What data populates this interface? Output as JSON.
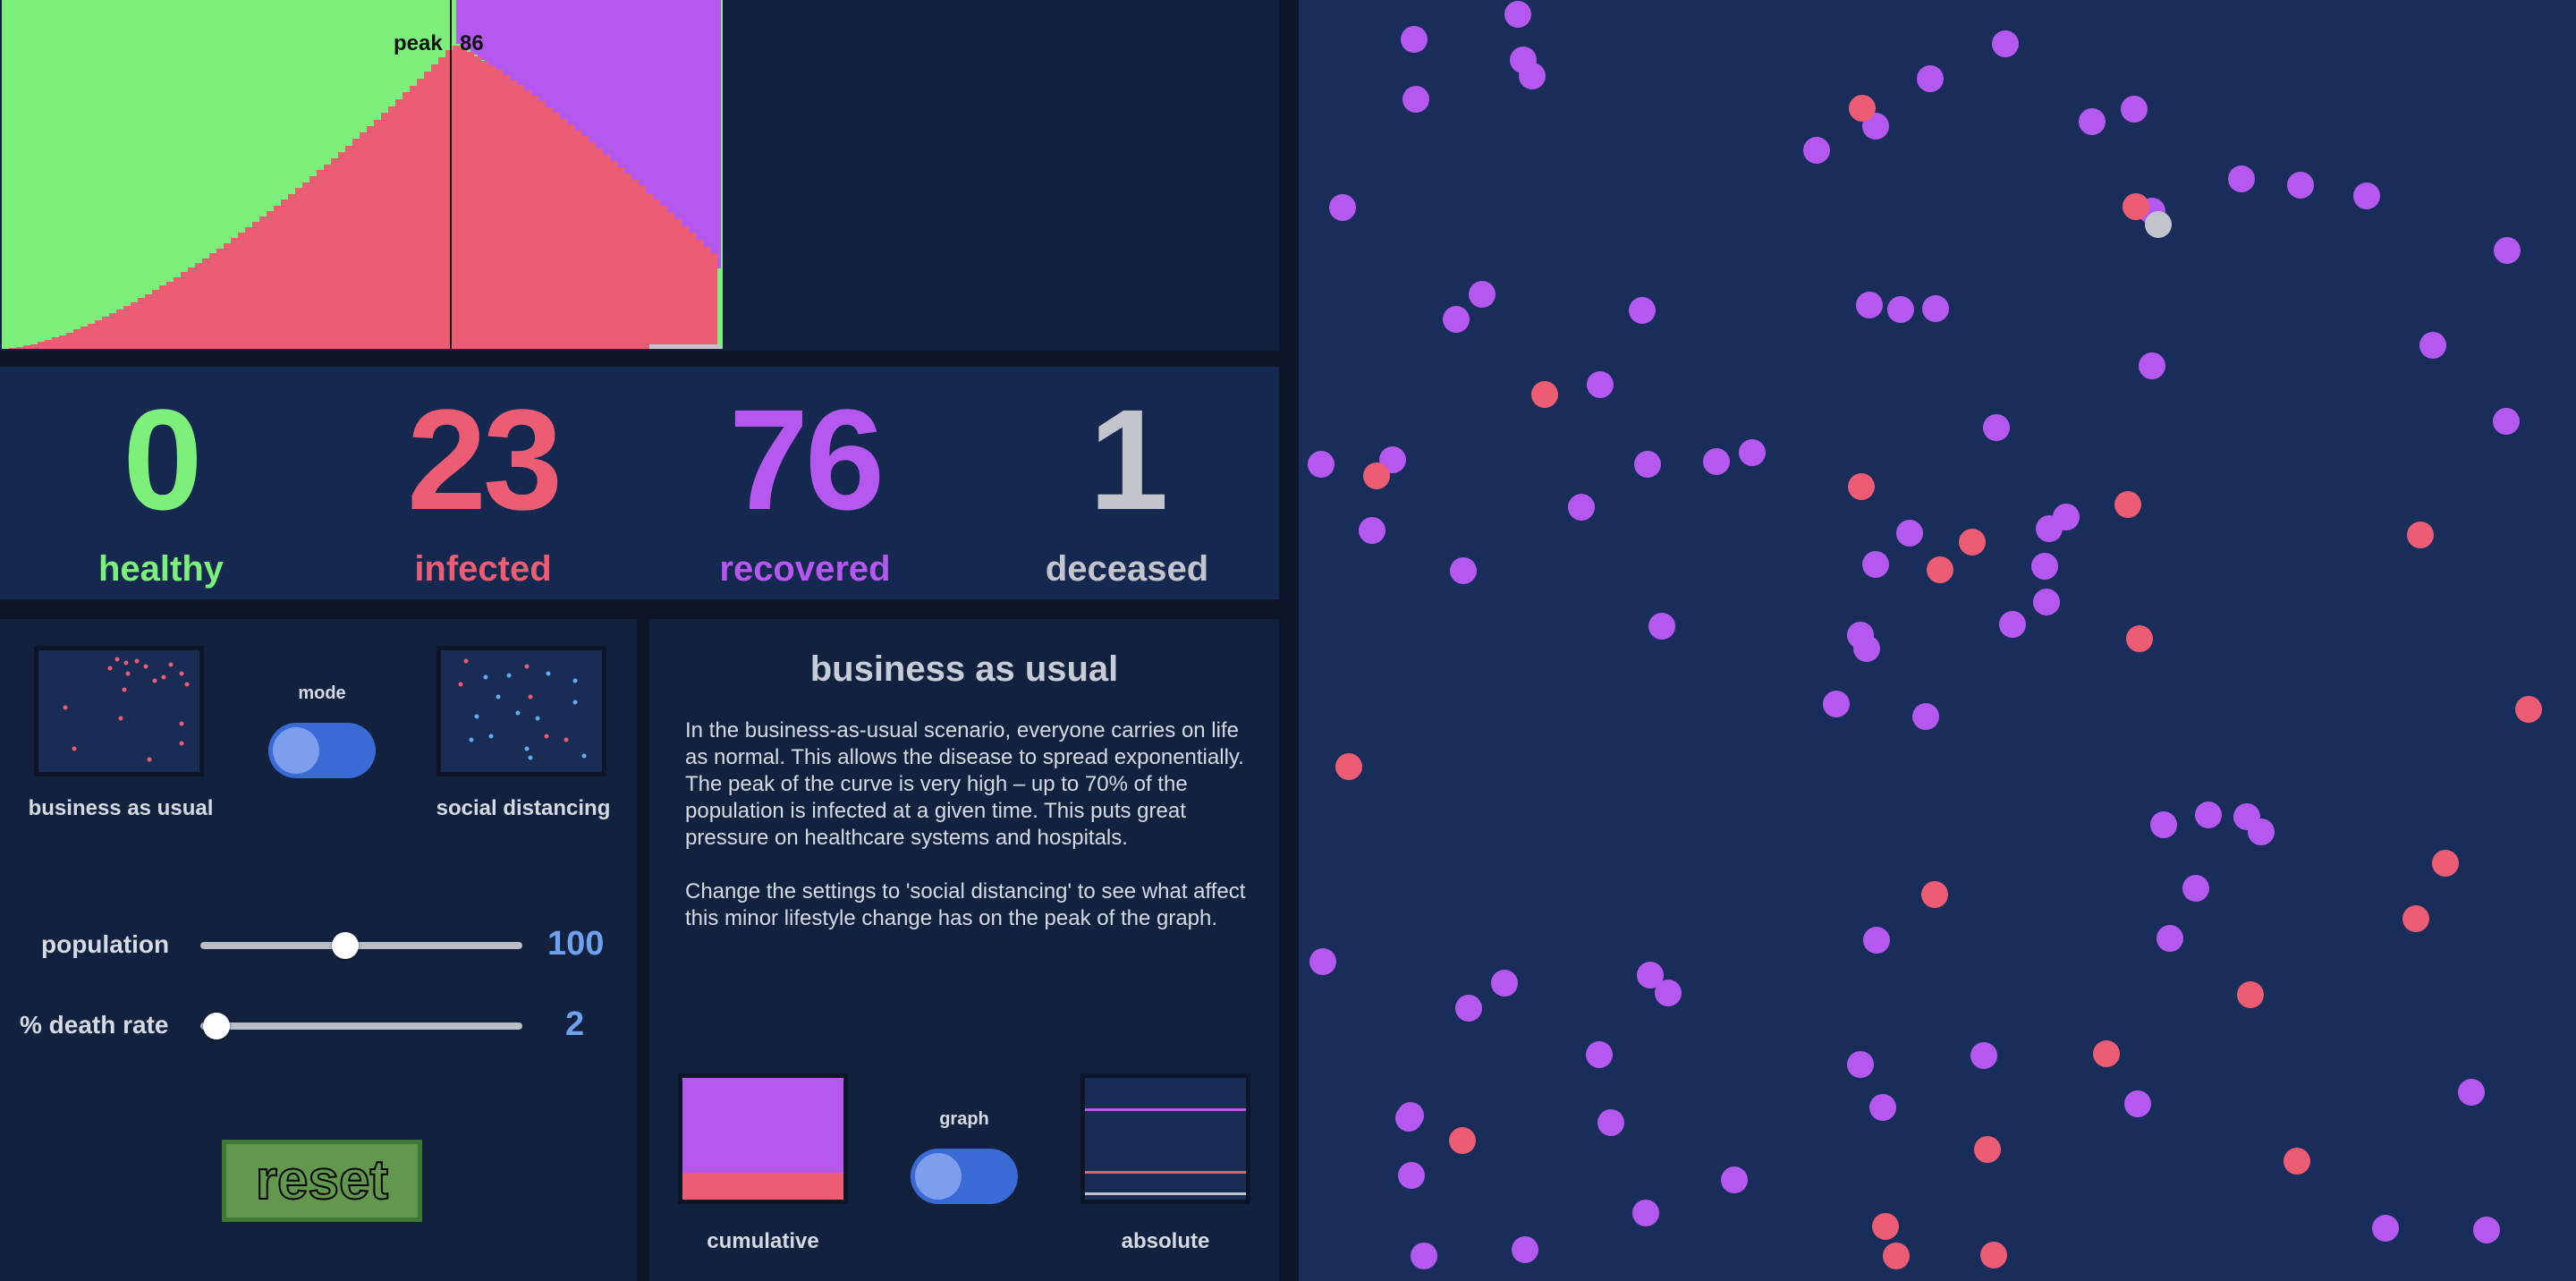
{
  "graph": {
    "peak_label": "peak",
    "peak_value": "86",
    "colors": {
      "healthy": "#7cf07a",
      "infected": "#ec5c72",
      "recovered": "#b558f0",
      "deceased": "#c2c6cc"
    }
  },
  "stats": [
    {
      "value": "0",
      "label": "healthy",
      "color": "#7cf07a"
    },
    {
      "value": "23",
      "label": "infected",
      "color": "#ec5c72"
    },
    {
      "value": "76",
      "label": "recovered",
      "color": "#b558f0"
    },
    {
      "value": "1",
      "label": "deceased",
      "color": "#c2c6cc"
    }
  ],
  "controls": {
    "mode_label": "mode",
    "mode_left_label": "business as usual",
    "mode_right_label": "social distancing",
    "population": {
      "label": "population",
      "value": "100",
      "fraction": 0.45
    },
    "death_rate": {
      "label": "% death rate",
      "value": "2",
      "fraction": 0.05
    },
    "reset_label": "reset"
  },
  "info": {
    "title": "business as usual",
    "paragraph1": "In the business-as-usual scenario, everyone carries on life as normal. This allows the disease to spread exponentially. The peak of the curve is very high – up to 70% of the population is infected at a given time. This puts great pressure on healthcare systems and hospitals.",
    "paragraph2": "Change the settings to 'social distancing' to see what affect this minor lifestyle change has on the peak of the graph.",
    "graph_toggle_label": "graph",
    "graph_left_label": "cumulative",
    "graph_right_label": "absolute"
  },
  "icons": {
    "mode_left_thumbnail": "scattered-dots-icon",
    "mode_right_thumbnail": "distanced-dots-icon",
    "graph_left_thumbnail": "stacked-area-icon",
    "graph_right_thumbnail": "line-graph-icon"
  },
  "simulation": {
    "colors": {
      "infected": "#ec5c72",
      "recovered": "#b558f0",
      "deceased": "#c2c6cc"
    },
    "dot_counts": {
      "infected": 23,
      "recovered": 76,
      "deceased": 1
    }
  }
}
